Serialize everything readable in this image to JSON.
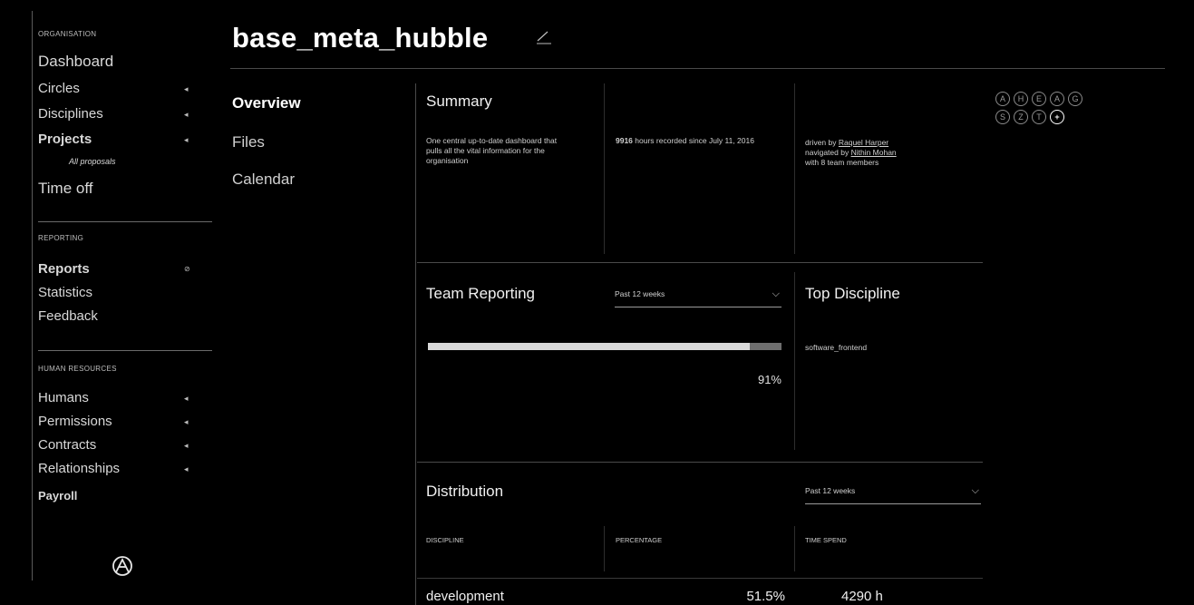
{
  "sidebar": {
    "sections": {
      "organisation": "ORGANISATION",
      "reporting": "REPORTING",
      "human_resources": "HUMAN RESOURCES"
    },
    "items": {
      "dashboard": "Dashboard",
      "circles": "Circles",
      "disciplines": "Disciplines",
      "projects": "Projects",
      "all_proposals": "All proposals",
      "timeoff": "Time off",
      "reports": "Reports",
      "statistics": "Statistics",
      "feedback": "Feedback",
      "humans": "Humans",
      "permissions": "Permissions",
      "contracts": "Contracts",
      "relationships": "Relationships",
      "payroll": "Payroll"
    }
  },
  "header": {
    "title": "base_meta_hubble"
  },
  "subnav": [
    "Overview",
    "Files",
    "Calendar"
  ],
  "summary": {
    "title": "Summary",
    "col1": "One central up-to-date dashboard that pulls all the vital information for the organisation",
    "col2_hours": "9916",
    "col2_rest": " hours recorded since July 11, 2016",
    "col3_prefix": "driven by ",
    "col3_driver": "Raquel Harper",
    "col3_nav_prefix": "navigated by ",
    "col3_navigator": "Nithin Mohan",
    "col3_team": "with 8 team members"
  },
  "team_reporting": {
    "title": "Team Reporting",
    "select": "Past 12 weeks",
    "progress": 0.91,
    "percent_label": "91%"
  },
  "top_discipline": {
    "title": "Top Discipline",
    "value": "software_frontend"
  },
  "distribution": {
    "title": "Distribution",
    "select": "Past 12 weeks",
    "headers": [
      "DISCIPLINE",
      "PERCENTAGE",
      "TIME SPEND"
    ],
    "rows": [
      {
        "discipline": "development",
        "percentage": "51.5%",
        "time": "4290 h"
      }
    ]
  },
  "letters": [
    "A",
    "H",
    "E",
    "A",
    "G",
    "S",
    "Z",
    "T",
    "+"
  ],
  "colors": {
    "background": "#000000",
    "text": "#e6e6e6",
    "progress_fill": "#d9d9d9",
    "progress_track": "#6e6e6e"
  }
}
